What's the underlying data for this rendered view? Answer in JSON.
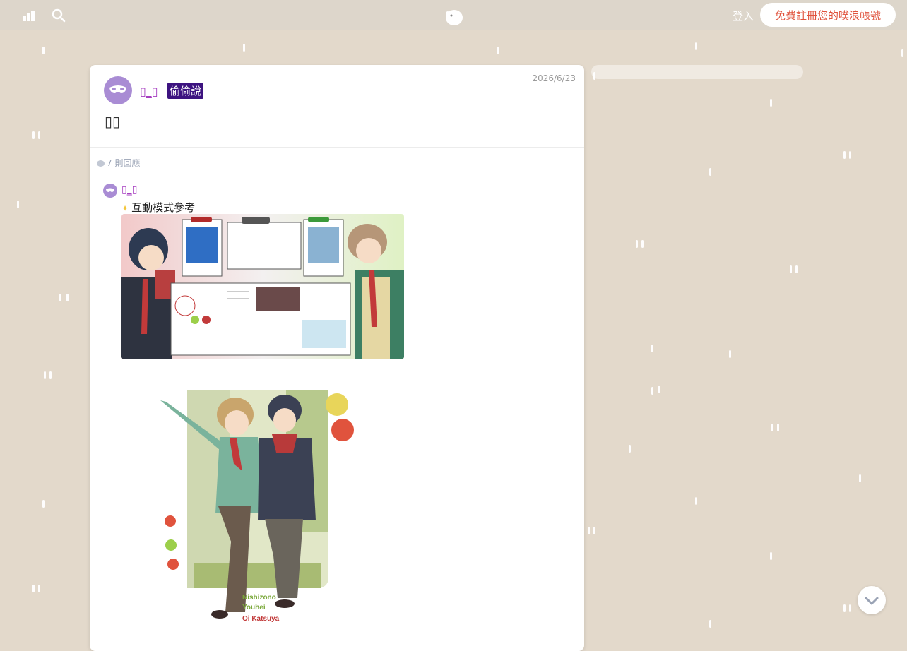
{
  "header": {
    "login_label": "登入",
    "signup_label": "免費註冊您的噗浪帳號"
  },
  "post": {
    "author": "▯_▯",
    "qualifier": "偷偷說",
    "date": "2026/6/23",
    "content": "▯▯",
    "response_count": "7 則回應"
  },
  "reply": {
    "author": "▯_▯",
    "text": "互動模式參考",
    "image2_caption": [
      "Nishizono",
      "Youhei",
      "Oi Katsuya"
    ]
  },
  "colors": {
    "background": "#e3d9cb",
    "accent": "#e0533d",
    "qualifier_bg": "#3d1380",
    "author": "#a63ec0"
  },
  "icons": [
    "stats-icon",
    "search-icon",
    "plurk-logo-icon",
    "chevron-down-icon",
    "mask-avatar-icon",
    "speech-bubble-icon",
    "sparkle-icon"
  ]
}
